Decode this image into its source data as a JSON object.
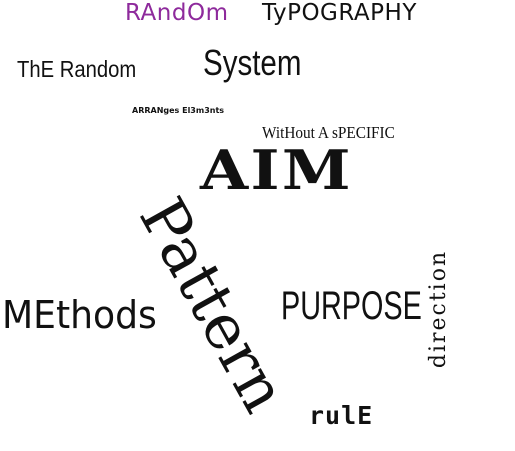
{
  "words": {
    "random": "RAndOm",
    "typography": "TyPOGRAPHY",
    "the_random": "ThE Random",
    "system": "System",
    "arranges": "ARRANges El3m3nts",
    "specific": "WitHout A sPECIFIC",
    "aim": "AIM",
    "pattern": "Pattern",
    "methods": "MEthods",
    "purpose": "PURPOSE",
    "rule": "rulE",
    "direction": "direction"
  },
  "colors": {
    "background": "#ffffff",
    "text": "#111111",
    "accent_random": "#8e2a9c"
  }
}
